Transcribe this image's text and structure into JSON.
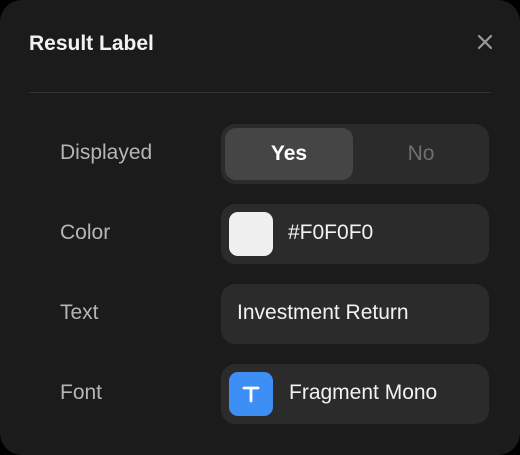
{
  "dialog": {
    "title": "Result Label",
    "close_icon": "close-icon"
  },
  "rows": {
    "displayed": {
      "label": "Displayed",
      "options": [
        "Yes",
        "No"
      ],
      "selected": "Yes"
    },
    "color": {
      "label": "Color",
      "value": "#F0F0F0",
      "swatch_color": "#F0F0F0"
    },
    "text": {
      "label": "Text",
      "value": "Investment Return"
    },
    "font": {
      "label": "Font",
      "value": "Fragment Mono",
      "icon": "text-font-icon",
      "icon_color": "#3D8FF5"
    }
  }
}
